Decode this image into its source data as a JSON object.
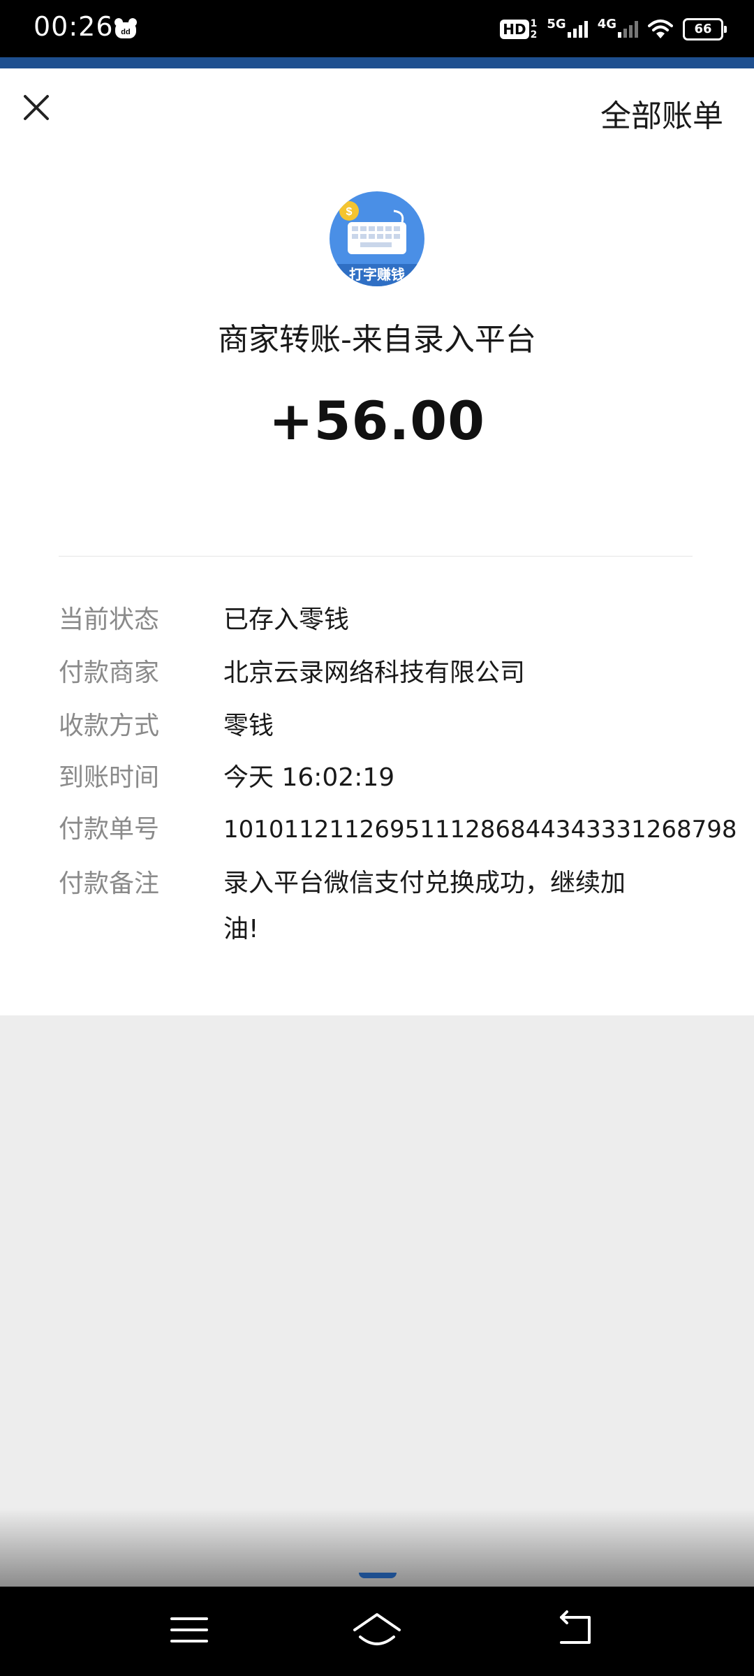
{
  "status_bar": {
    "time": "00:26",
    "network_hd": "HD",
    "network_hd_sim1": "1",
    "network_hd_sim2": "2",
    "network_5g": "5G",
    "network_4g": "4G",
    "battery": "66",
    "icons": [
      "notification-app-icon",
      "wifi-icon",
      "battery-icon",
      "signal-icon"
    ]
  },
  "header": {
    "close_icon": "close-icon",
    "all_bills": "全部账单"
  },
  "transaction": {
    "logo_text": "打字赚钱",
    "merchant_title": "商家转账-来自录入平台",
    "amount": "+56.00"
  },
  "details": {
    "status": {
      "label": "当前状态",
      "value": "已存入零钱"
    },
    "merchant": {
      "label": "付款商家",
      "value": "北京云录网络科技有限公司"
    },
    "method": {
      "label": "收款方式",
      "value": "零钱"
    },
    "arrival_time": {
      "label": "到账时间",
      "value": "今天 16:02:19"
    },
    "order_no": {
      "label": "付款单号",
      "value": "1010112112695111286844343331268798"
    },
    "remark": {
      "label": "付款备注",
      "value": "录入平台微信支付兑换成功，继续加油!"
    }
  },
  "nav_bar": {
    "icons": [
      "menu-icon",
      "home-icon",
      "back-icon"
    ]
  },
  "colors": {
    "accent_strip": "#1e4f8f",
    "logo_blue": "#4a8fe6",
    "label_gray": "#8a8a8a",
    "text_dark": "#191919"
  }
}
